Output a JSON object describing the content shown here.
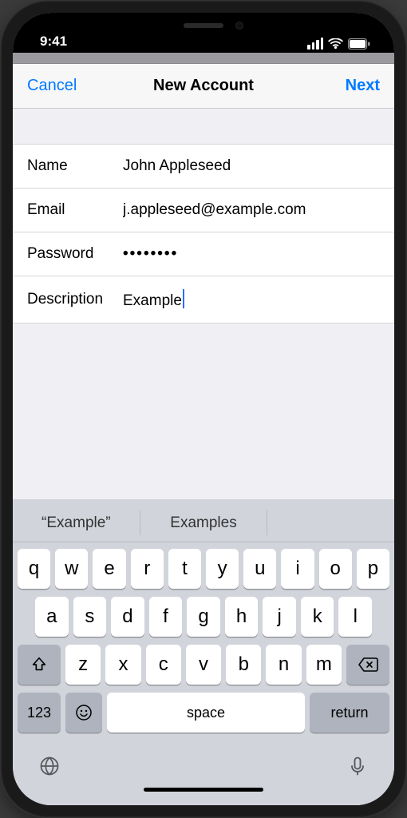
{
  "status": {
    "time": "9:41"
  },
  "nav": {
    "cancel": "Cancel",
    "title": "New Account",
    "next": "Next"
  },
  "form": {
    "name_label": "Name",
    "name_value": "John Appleseed",
    "email_label": "Email",
    "email_value": "j.appleseed@example.com",
    "password_label": "Password",
    "password_value": "••••••••",
    "description_label": "Description",
    "description_value": "Example"
  },
  "suggestions": {
    "s1": "“Example”",
    "s2": "Examples",
    "s3": ""
  },
  "keyboard": {
    "r1": [
      "q",
      "w",
      "e",
      "r",
      "t",
      "y",
      "u",
      "i",
      "o",
      "p"
    ],
    "r2": [
      "a",
      "s",
      "d",
      "f",
      "g",
      "h",
      "j",
      "k",
      "l"
    ],
    "r3": [
      "z",
      "x",
      "c",
      "v",
      "b",
      "n",
      "m"
    ],
    "numbers": "123",
    "space": "space",
    "return": "return"
  }
}
